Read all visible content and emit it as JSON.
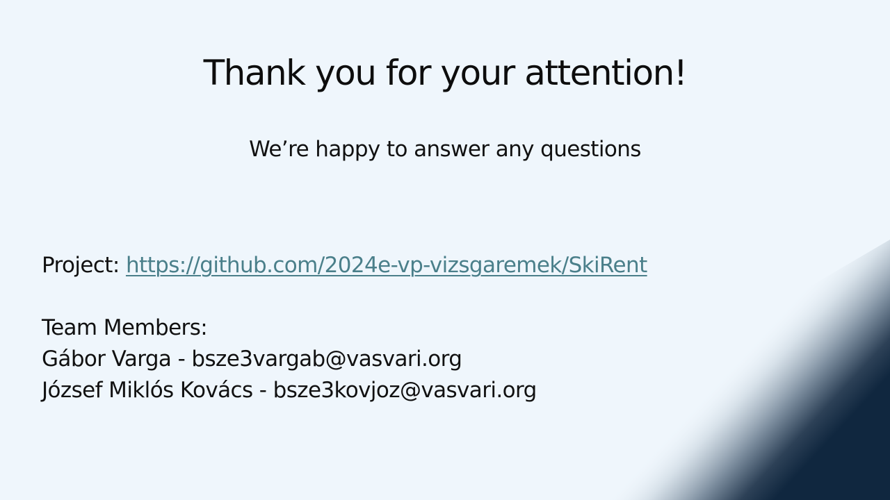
{
  "slide": {
    "title": "Thank you for your attention!",
    "subtitle": "We’re happy to answer any questions",
    "project_label": "Project: ",
    "project_link": "https://github.com/2024e-vp-vizsgaremek/SkiRent",
    "team_heading": "Team Members:",
    "members": [
      "Gábor Varga - bsze3vargab@vasvari.org",
      "József Miklós Kovács - bsze3kovjoz@vasvari.org"
    ]
  },
  "colors": {
    "background": "#eff6fc",
    "corner_dark": "#10273f",
    "link": "#4a7f8a",
    "text": "#111111"
  }
}
